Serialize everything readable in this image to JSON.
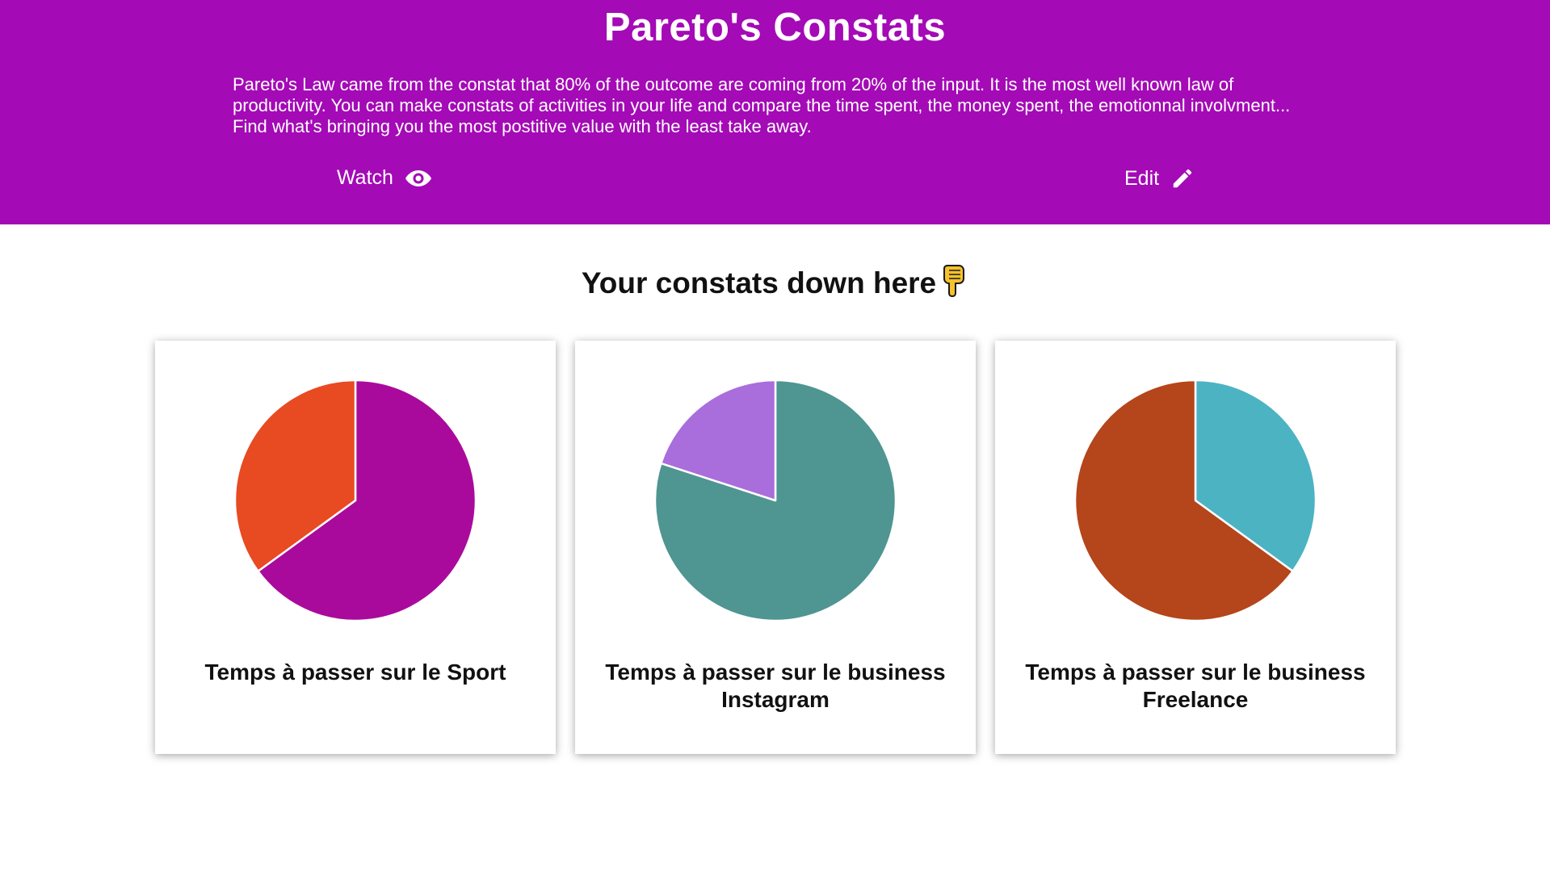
{
  "header": {
    "title": "Pareto's Constats",
    "intro": "Pareto's Law came from the constat that 80% of the outcome are coming from 20% of the input. It is the most well known law of productivity. You can make constats of activities in your life and compare the time spent, the money spent, the emotionnal involvment... Find what's bringing you the most postitive value with the least take away.",
    "watch_label": "Watch",
    "watch_icon": "eye-icon",
    "edit_label": "Edit",
    "edit_icon": "pencil-icon",
    "background_color": "#a40ab6"
  },
  "section": {
    "title": "Your constats down here",
    "title_icon": "pointing-down-hand-icon"
  },
  "constats": [
    {
      "title": "Temps à passer sur le Sport",
      "slices": [
        {
          "value": 65,
          "color": "#aa0a9c"
        },
        {
          "value": 35,
          "color": "#e84a22"
        }
      ]
    },
    {
      "title": "Temps à passer sur le business Instagram",
      "slices": [
        {
          "value": 80,
          "color": "#4f9591"
        },
        {
          "value": 20,
          "color": "#a96ddc"
        }
      ]
    },
    {
      "title": "Temps à passer sur le business Freelance",
      "slices": [
        {
          "value": 35,
          "color": "#4cb3c3"
        },
        {
          "value": 65,
          "color": "#b5451a"
        }
      ]
    }
  ]
}
